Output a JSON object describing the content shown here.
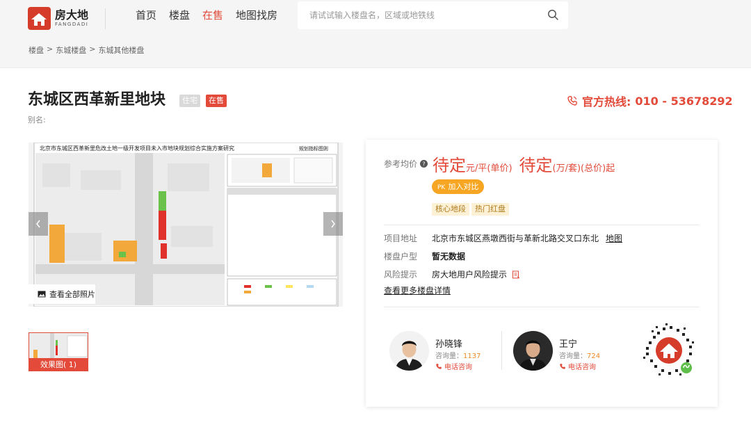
{
  "header": {
    "logo_cn": "房大地",
    "logo_en": "FANGDADI",
    "nav": [
      {
        "label": "首页",
        "active": false
      },
      {
        "label": "楼盘",
        "active": false
      },
      {
        "label": "在售",
        "active": true
      },
      {
        "label": "地图找房",
        "active": false
      }
    ],
    "search_placeholder": "请试试输入楼盘名，区域或地铁线",
    "search_value": ""
  },
  "breadcrumb": [
    "楼盘",
    ">",
    "东城楼盘",
    ">",
    "东城其他楼盘"
  ],
  "project": {
    "title": "东城区西革新里地块",
    "tag_type": "住宅",
    "tag_status": "在售",
    "alias_label": "别名:",
    "hotline_label": "官方热线:",
    "hotline_number": "010 - 53678292"
  },
  "gallery": {
    "image_title": "北京市东城区西革新里危改土地一级开发项目未入市地块规划综合实施方案研究",
    "image_subtitle": "规划指标图则",
    "view_all": "查看全部照片",
    "thumb_label": "效果图( 1)",
    "prev_icon": "chevron-left-icon",
    "next_icon": "chevron-right-icon"
  },
  "card": {
    "price_label": "参考均价",
    "price_unit_value": "待定",
    "price_unit_text": "元/平(单价)",
    "price_total_value": "待定",
    "price_total_text": "(万/套)(总价)起",
    "pk_prefix": "PK",
    "pk_label": "加入对比",
    "features": [
      "核心地段",
      "热门红盘"
    ],
    "info": [
      {
        "key": "项目地址",
        "value": "北京市东城区燕墩西街与革新北路交叉口东北",
        "link": "地图"
      },
      {
        "key": "楼盘户型",
        "value": "暂无数据"
      },
      {
        "key": "风险提示",
        "value": "房大地用户风险提示"
      }
    ],
    "more_link": "查看更多楼盘详情",
    "agents": [
      {
        "name": "孙晓锋",
        "count_label": "咨询量：",
        "count": "1137",
        "call": "电话咨询"
      },
      {
        "name": "王宁",
        "count_label": "咨询量：",
        "count": "724",
        "call": "电话咨询"
      }
    ]
  },
  "colors": {
    "accent": "#e34a3a",
    "pk_orange": "#f6a623",
    "tag_bg": "#fdf1d5",
    "header_bg": "#f5f5f5"
  }
}
